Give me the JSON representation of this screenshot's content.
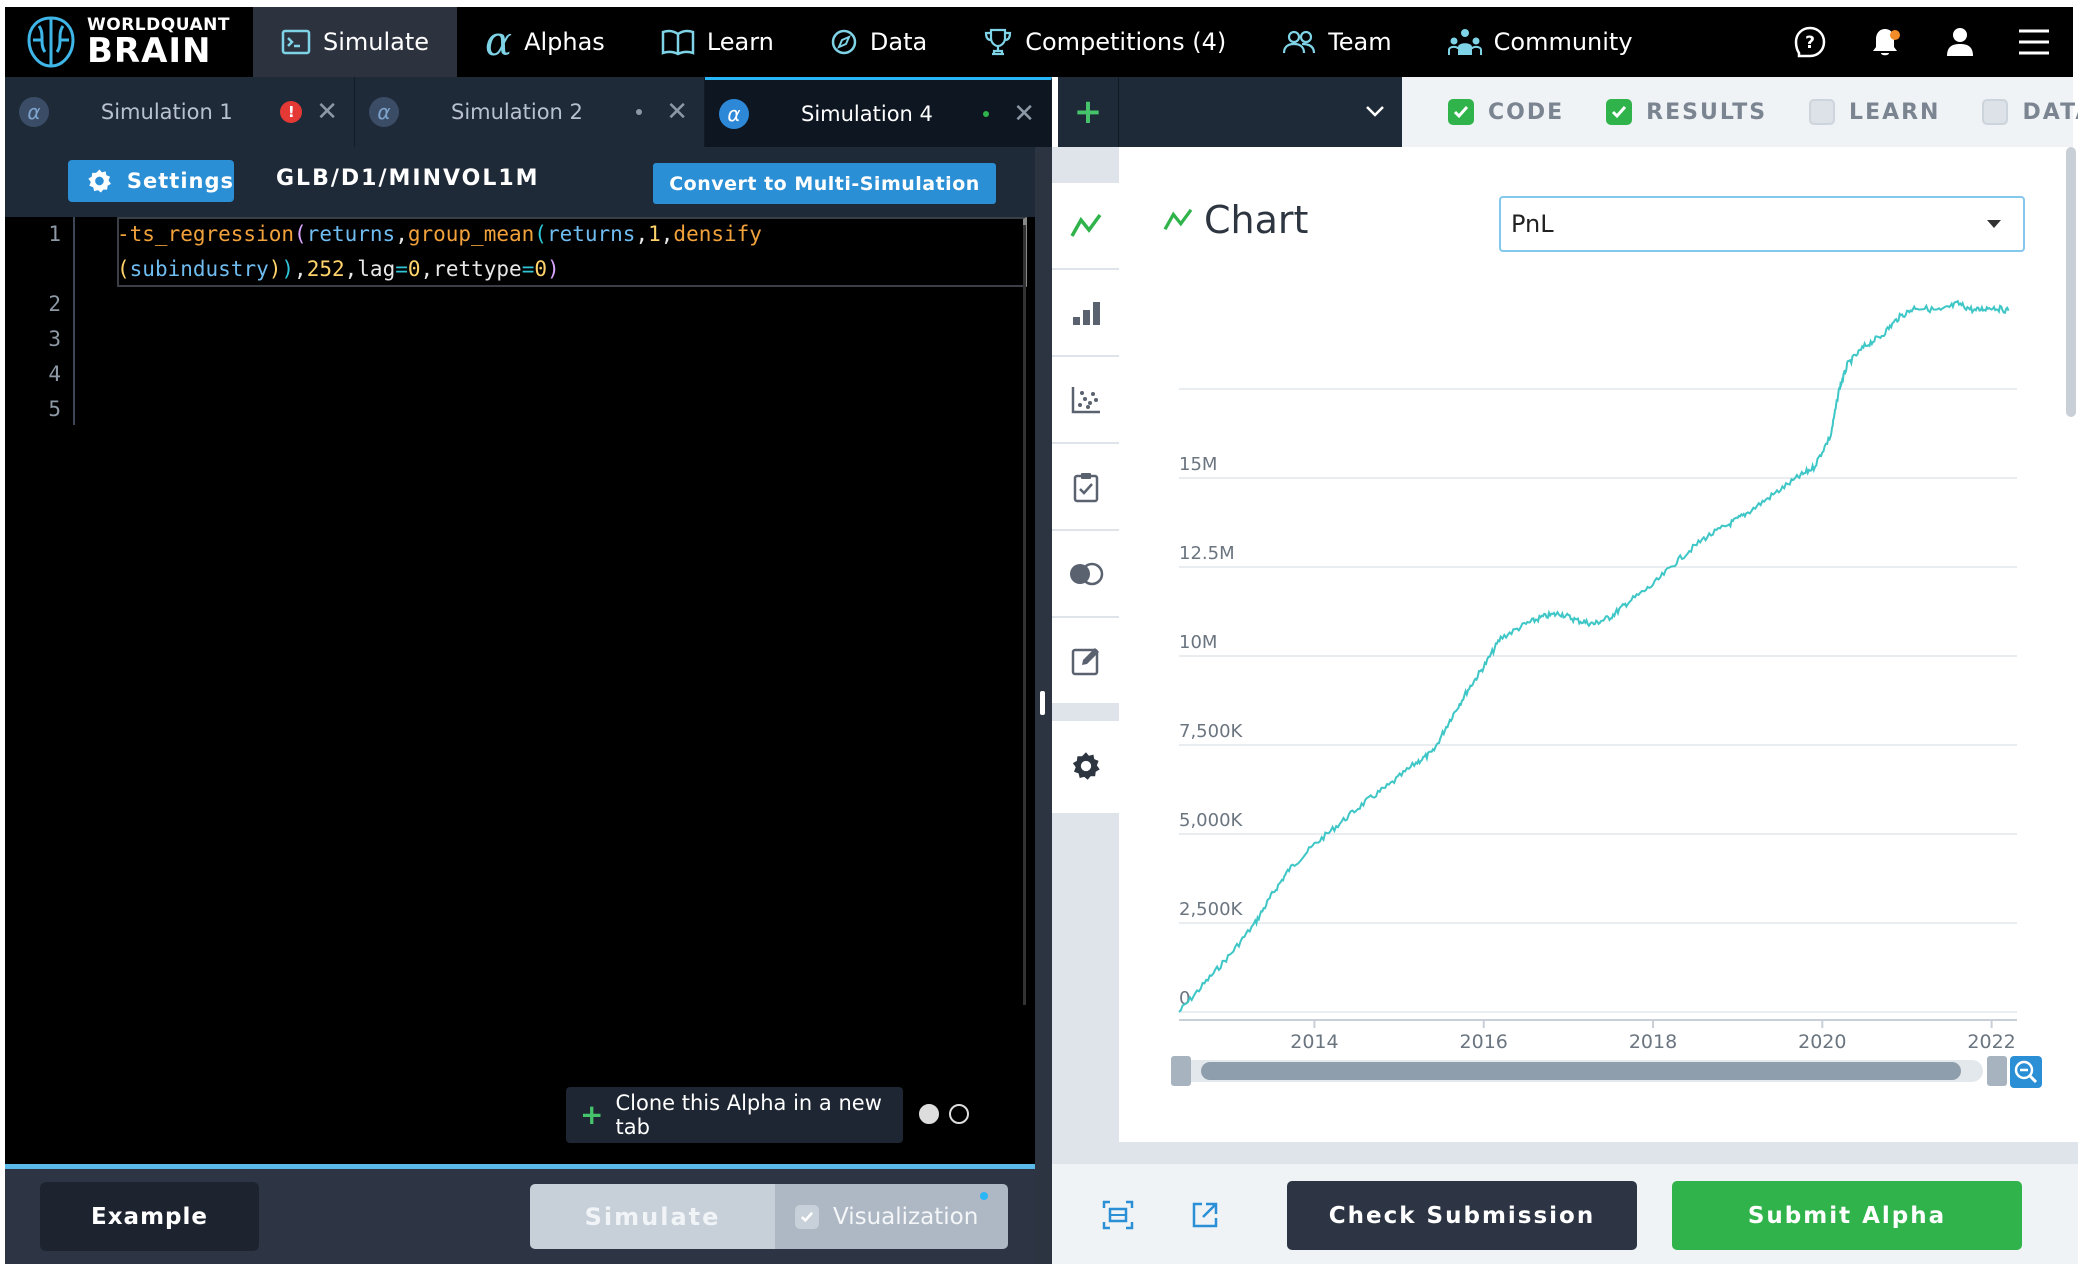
{
  "brand": {
    "line1": "WORLDQUANT",
    "line2": "BRAIN"
  },
  "nav": [
    {
      "label": "Simulate",
      "icon": "terminal-icon",
      "active": true
    },
    {
      "label": "Alphas",
      "icon": "alpha-icon"
    },
    {
      "label": "Learn",
      "icon": "book-icon"
    },
    {
      "label": "Data",
      "icon": "compass-icon"
    },
    {
      "label": "Competitions (4)",
      "icon": "trophy-icon"
    },
    {
      "label": "Team",
      "icon": "team-icon"
    },
    {
      "label": "Community",
      "icon": "community-icon"
    }
  ],
  "tabs": [
    {
      "label": "Simulation 1",
      "status": "error",
      "status_color": "#e53935"
    },
    {
      "label": "Simulation 2",
      "status": "neutral",
      "status_color": "#8d98a6"
    },
    {
      "label": "Simulation 4",
      "status": "running",
      "status_color": "#2fb34a",
      "active": true
    }
  ],
  "new_tab_label": "+",
  "panels": [
    {
      "label": "CODE",
      "checked": true
    },
    {
      "label": "RESULTS",
      "checked": true
    },
    {
      "label": "LEARN",
      "checked": false
    },
    {
      "label": "DATA",
      "checked": false
    }
  ],
  "editor": {
    "settings_label": "Settings",
    "sim_path": "GLB/D1/MINVOL1M",
    "convert_label": "Convert to Multi-Simulation",
    "line_numbers": [
      "1",
      "",
      "2",
      "3",
      "4",
      "5"
    ],
    "clone_label": "Clone this Alpha in a new tab"
  },
  "bottom": {
    "example_label": "Example",
    "simulate_label": "Simulate",
    "visualization_label": "Visualization",
    "check_label": "Check Submission",
    "submit_label": "Submit Alpha"
  },
  "chart_panel": {
    "title": "Chart",
    "selected_metric": "PnL"
  },
  "colors": {
    "accent": "#2b8fd6",
    "success": "#2fb34a",
    "chart_line": "#3fc6c6",
    "active_tab_border": "#29b6f6"
  },
  "chart_data": {
    "type": "line",
    "series": [
      {
        "x": [
          2012.4,
          2012.7,
          2013.0,
          2013.3,
          2013.5,
          2013.7,
          2014.0,
          2014.3,
          2014.6,
          2014.9,
          2015.2,
          2015.4,
          2015.6,
          2015.8,
          2016.0,
          2016.2,
          2016.5,
          2016.7,
          2016.9,
          2017.1,
          2017.3,
          2017.5,
          2017.7,
          2018.0,
          2018.3,
          2018.6,
          2018.9,
          2019.1,
          2019.4,
          2019.7,
          2019.9,
          2020.1,
          2020.2,
          2020.3,
          2020.5,
          2020.7,
          2020.9,
          2021.1,
          2021.4,
          2021.6,
          2021.8,
          2022.0,
          2022.2
        ],
        "y": [
          0,
          800000,
          1600000,
          2500000,
          3300000,
          4000000,
          4700000,
          5300000,
          5900000,
          6400000,
          7000000,
          7300000,
          8200000,
          9000000,
          9700000,
          10500000,
          10900000,
          11100000,
          11200000,
          11000000,
          10900000,
          11100000,
          11500000,
          12000000,
          12700000,
          13300000,
          13700000,
          14000000,
          14500000,
          15000000,
          15300000,
          16200000,
          17500000,
          18200000,
          18700000,
          19000000,
          19500000,
          19800000,
          19700000,
          19900000,
          19700000,
          19800000,
          19700000
        ]
      }
    ],
    "yticks": [
      {
        "value": 0,
        "label": "0"
      },
      {
        "value": 2500000,
        "label": "2,500K"
      },
      {
        "value": 5000000,
        "label": "5,000K"
      },
      {
        "value": 7500000,
        "label": "7,500K"
      },
      {
        "value": 10000000,
        "label": "10M"
      },
      {
        "value": 12500000,
        "label": "12.5M"
      },
      {
        "value": 15000000,
        "label": "15M"
      },
      {
        "value": 17500000,
        "label": ""
      }
    ],
    "xticks": [
      2014,
      2016,
      2018,
      2020,
      2022
    ],
    "xlim": [
      2012.4,
      2022.3
    ],
    "ylim": [
      0,
      20000000
    ],
    "grid": true
  }
}
